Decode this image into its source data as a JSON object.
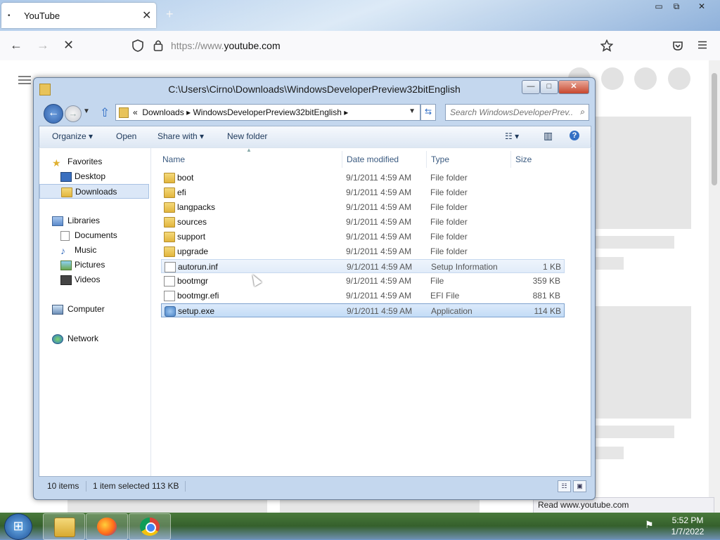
{
  "browser": {
    "tab_bullet": "•",
    "tab_title": "YouTube",
    "tab_close": "✕",
    "new_tab": "+",
    "win_min": "▭",
    "win_restore": "⧉",
    "win_close": "✕",
    "back": "←",
    "forward": "→",
    "stop": "✕",
    "url_scheme": "https://www.",
    "url_host": "youtube.com",
    "status_text": "Read www.youtube.com"
  },
  "explorer": {
    "title": "C:\\Users\\Cirno\\Downloads\\WindowsDeveloperPreview32bitEnglish",
    "caption": {
      "min": "—",
      "max": "□",
      "close": "✕"
    },
    "address": {
      "overflow": "«",
      "crumbs": [
        "Downloads",
        "WindowsDeveloperPreview32bitEnglish"
      ],
      "sep": "▸"
    },
    "search_placeholder": "Search WindowsDeveloperPrev...",
    "commands": {
      "organize": "Organize ▾",
      "open": "Open",
      "share_with": "Share with ▾",
      "new_folder": "New folder",
      "views": "☷ ▾",
      "preview": "▥",
      "help": "?"
    },
    "nav": {
      "favorites": "Favorites",
      "desktop": "Desktop",
      "downloads": "Downloads",
      "libraries": "Libraries",
      "documents": "Documents",
      "music": "Music",
      "pictures": "Pictures",
      "videos": "Videos",
      "computer": "Computer",
      "network": "Network"
    },
    "columns": {
      "name": "Name",
      "date": "Date modified",
      "type": "Type",
      "size": "Size"
    },
    "files": [
      {
        "name": "boot",
        "date": "9/1/2011 4:59 AM",
        "type": "File folder",
        "size": "",
        "icon": "folder"
      },
      {
        "name": "efi",
        "date": "9/1/2011 4:59 AM",
        "type": "File folder",
        "size": "",
        "icon": "folder"
      },
      {
        "name": "langpacks",
        "date": "9/1/2011 4:59 AM",
        "type": "File folder",
        "size": "",
        "icon": "folder"
      },
      {
        "name": "sources",
        "date": "9/1/2011 4:59 AM",
        "type": "File folder",
        "size": "",
        "icon": "folder"
      },
      {
        "name": "support",
        "date": "9/1/2011 4:59 AM",
        "type": "File folder",
        "size": "",
        "icon": "folder"
      },
      {
        "name": "upgrade",
        "date": "9/1/2011 4:59 AM",
        "type": "File folder",
        "size": "",
        "icon": "folder"
      },
      {
        "name": "autorun.inf",
        "date": "9/1/2011 4:59 AM",
        "type": "Setup Information",
        "size": "1 KB",
        "icon": "settings-file"
      },
      {
        "name": "bootmgr",
        "date": "9/1/2011 4:59 AM",
        "type": "File",
        "size": "359 KB",
        "icon": "file"
      },
      {
        "name": "bootmgr.efi",
        "date": "9/1/2011 4:59 AM",
        "type": "EFI File",
        "size": "881 KB",
        "icon": "file"
      },
      {
        "name": "setup.exe",
        "date": "9/1/2011 4:59 AM",
        "type": "Application",
        "size": "114 KB",
        "icon": "setup"
      }
    ],
    "status": {
      "count": "10 items",
      "selection": "1 item selected  113 KB"
    }
  },
  "taskbar": {
    "start_glyph": "⊞",
    "time": "5:52 PM",
    "date": "1/7/2022"
  }
}
